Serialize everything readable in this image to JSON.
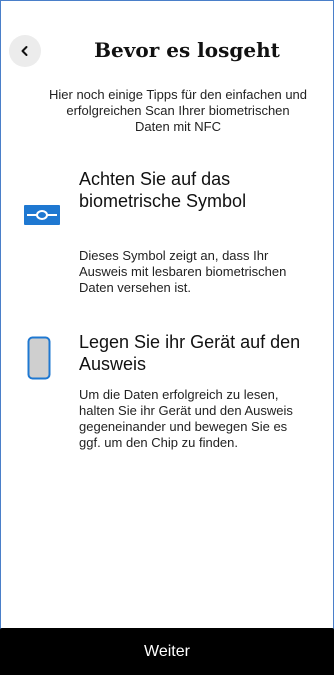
{
  "header": {
    "title": "Bevor es losgeht",
    "back_icon": "chevron-left-icon"
  },
  "intro": "Hier noch einige Tipps für den einfachen und erfolgreichen Scan Ihrer biometrischen Daten mit NFC",
  "tips": [
    {
      "icon": "biometric-symbol-icon",
      "title": "Achten Sie auf das biometrische Symbol",
      "text": "Dieses Symbol zeigt an, dass Ihr Ausweis mit lesbaren biometrischen Daten versehen ist."
    },
    {
      "icon": "phone-icon",
      "title": "Legen Sie ihr Gerät auf den Ausweis",
      "text": "Um die Daten erfolgreich zu lesen, halten Sie ihr Gerät und den Ausweis gegeneinander und bewegen Sie es ggf. um den Chip zu finden."
    }
  ],
  "footer": {
    "continue_label": "Weiter"
  },
  "colors": {
    "accent": "#1f78d1",
    "phone_fill": "#cfcfcf",
    "button_bg": "#000000",
    "button_text": "#ffffff"
  }
}
